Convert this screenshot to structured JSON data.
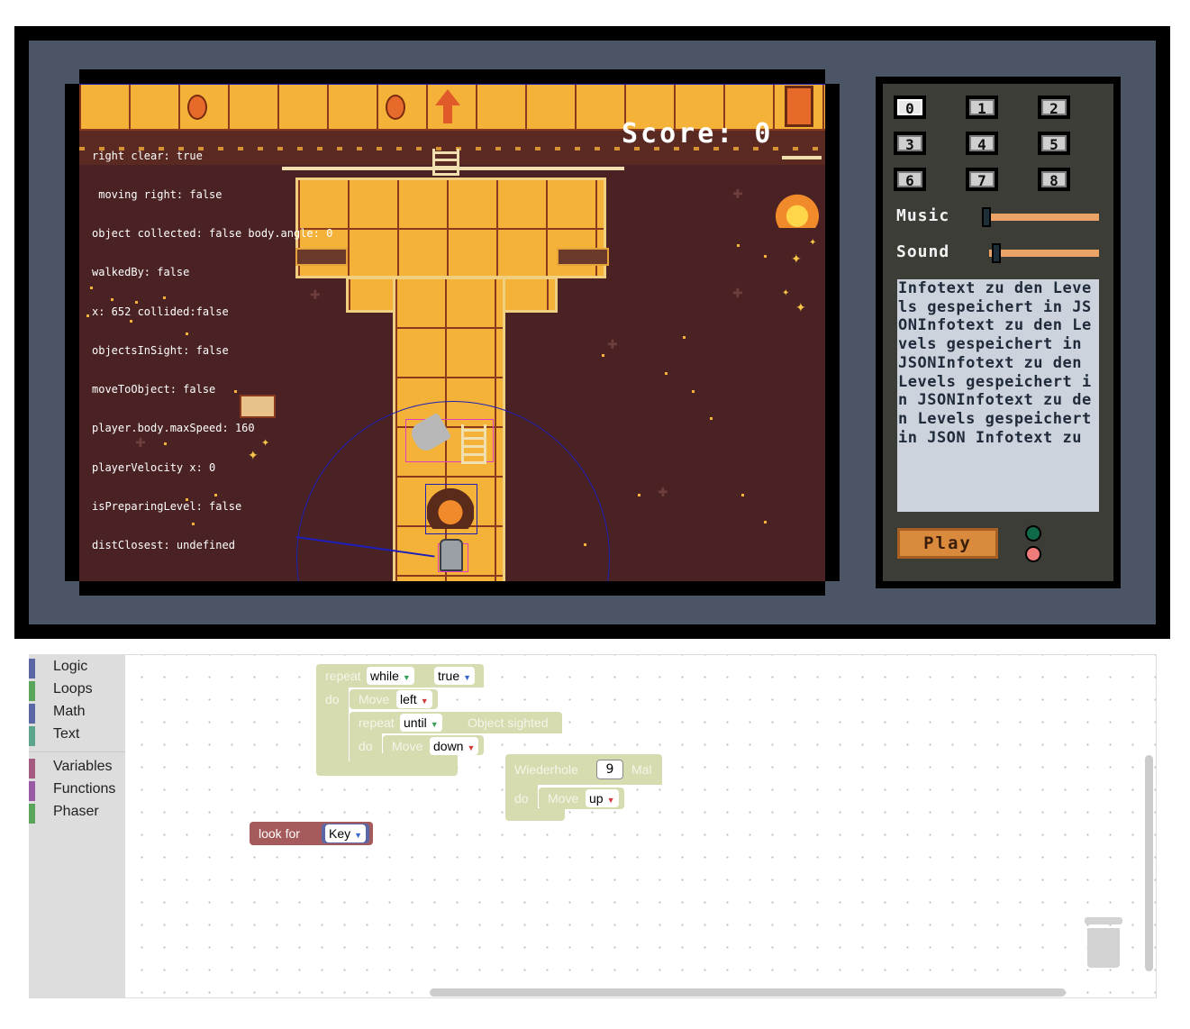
{
  "game": {
    "score_label": "Score: 0",
    "debug_lines": [
      "right clear: true",
      " moving right: false",
      "object collected: false body.angle: 0",
      "walkedBy: false",
      "x: 652 collided:false",
      "objectsInSight: false",
      "moveToObject: false",
      "player.body.maxSpeed: 160",
      "playerVelocity x: 0",
      "isPreparingLevel: false",
      "distClosest: undefined"
    ]
  },
  "panel": {
    "levels": [
      "0",
      "1",
      "2",
      "3",
      "4",
      "5",
      "6",
      "7",
      "8"
    ],
    "selected_level": "0",
    "music_label": "Music",
    "sound_label": "Sound",
    "music_level": 0.0,
    "sound_level": 0.05,
    "info_text": "Infotext zu den Levels gespeichert in JSONInfotext zu den Levels gespeichert in JSONInfotext zu den Levels gespeichert in JSONInfotext zu den Levels gespeichert in JSON Infotext zu",
    "play_label": "Play",
    "led_colors": [
      "#0f6b47",
      "#f07b7b"
    ]
  },
  "toolbox": {
    "categories": [
      {
        "label": "Logic",
        "color": "#5b67a5"
      },
      {
        "label": "Loops",
        "color": "#5ba55b"
      },
      {
        "label": "Math",
        "color": "#5b67a5"
      },
      {
        "label": "Text",
        "color": "#5ba58c"
      },
      {
        "label": "Variables",
        "color": "#a55b80"
      },
      {
        "label": "Functions",
        "color": "#995ba5"
      },
      {
        "label": "Phaser",
        "color": "#5ba55b"
      }
    ]
  },
  "workspace": {
    "block1": {
      "repeat": "repeat",
      "while": "while",
      "true": "true",
      "do": "do",
      "move1": "Move",
      "left": "left",
      "repeat2": "repeat",
      "until": "until",
      "object_sighted": "Object sighted",
      "do2": "do",
      "move2": "Move",
      "down": "down"
    },
    "block2": {
      "wiederhole": "Wiederhole",
      "count": "9",
      "mal": "Mal",
      "do": "do",
      "move": "Move",
      "up": "up"
    },
    "block3": {
      "look_for": "look for",
      "key": "Key"
    }
  }
}
